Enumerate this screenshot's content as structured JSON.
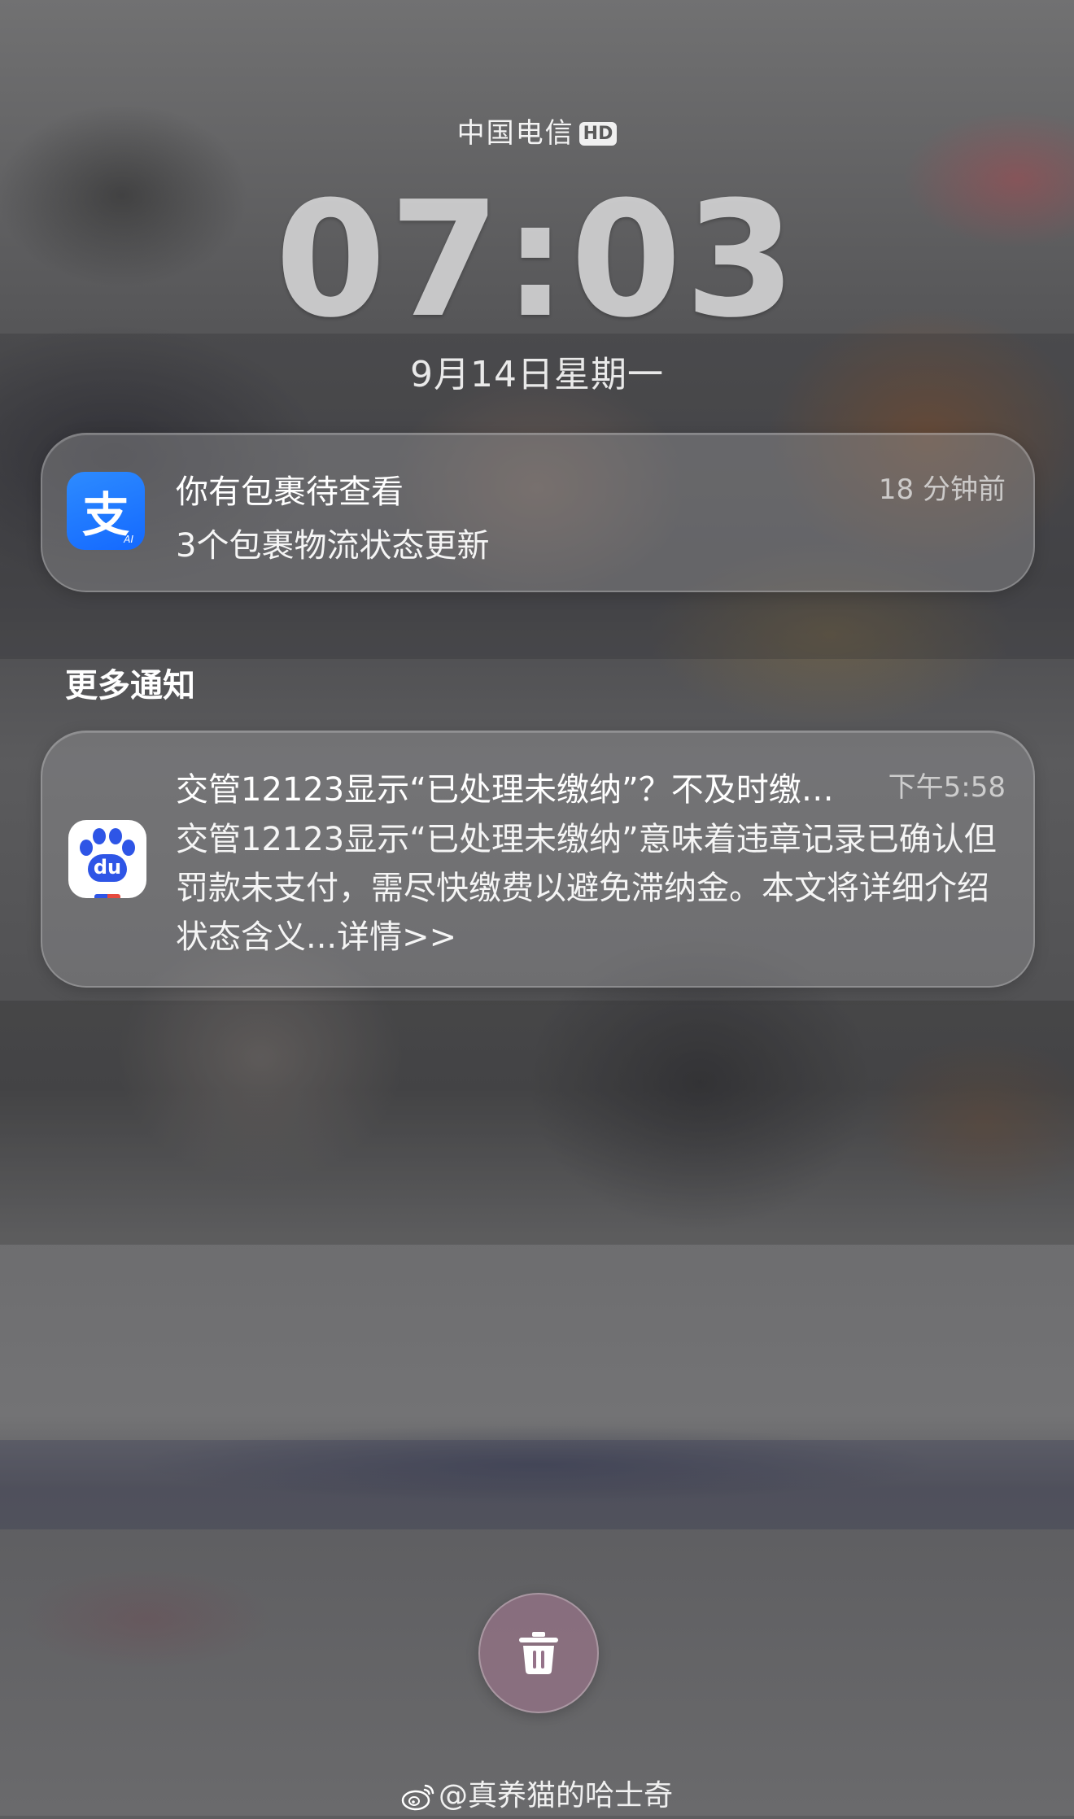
{
  "status": {
    "carrier": "中国电信",
    "network_badge": "HD"
  },
  "lockscreen": {
    "time": "07:03",
    "date": "9月14日星期一"
  },
  "notifications": [
    {
      "app_icon": "alipay-icon",
      "icon_glyph": "支",
      "icon_badge": "AI",
      "title": "你有包裹待查看",
      "text": "3个包裹物流状态更新",
      "time": "18 分钟前"
    }
  ],
  "more_notifications": {
    "header": "更多通知",
    "items": [
      {
        "app_icon": "baidu-icon",
        "icon_glyph": "du",
        "title": "交管12123显示“已处理未缴纳”？不及时缴…",
        "text": "交管12123显示“已处理未缴纳”意味着违章记录已确认但罚款未支付，需尽快缴费以避免滞纳金。本文将详细介绍状态含义...详情>>",
        "time": "下午5:58"
      }
    ]
  },
  "actions": {
    "clear_icon": "trash-icon"
  },
  "watermark": {
    "icon": "weibo-icon",
    "text": "@真养猫的哈士奇"
  },
  "colors": {
    "alipay_blue": "#1677ff",
    "baidu_blue": "#2e55e6",
    "card_glass": "#969698",
    "trash_button": "#96738a"
  }
}
